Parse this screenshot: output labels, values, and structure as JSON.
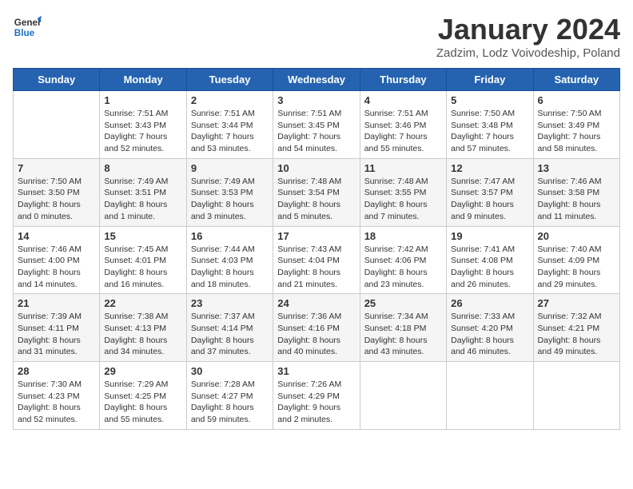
{
  "header": {
    "logo_general": "General",
    "logo_blue": "Blue",
    "title": "January 2024",
    "subtitle": "Zadzim, Lodz Voivodeship, Poland"
  },
  "days_of_week": [
    "Sunday",
    "Monday",
    "Tuesday",
    "Wednesday",
    "Thursday",
    "Friday",
    "Saturday"
  ],
  "weeks": [
    [
      {
        "day": "",
        "text": ""
      },
      {
        "day": "1",
        "text": "Sunrise: 7:51 AM\nSunset: 3:43 PM\nDaylight: 7 hours\nand 52 minutes."
      },
      {
        "day": "2",
        "text": "Sunrise: 7:51 AM\nSunset: 3:44 PM\nDaylight: 7 hours\nand 53 minutes."
      },
      {
        "day": "3",
        "text": "Sunrise: 7:51 AM\nSunset: 3:45 PM\nDaylight: 7 hours\nand 54 minutes."
      },
      {
        "day": "4",
        "text": "Sunrise: 7:51 AM\nSunset: 3:46 PM\nDaylight: 7 hours\nand 55 minutes."
      },
      {
        "day": "5",
        "text": "Sunrise: 7:50 AM\nSunset: 3:48 PM\nDaylight: 7 hours\nand 57 minutes."
      },
      {
        "day": "6",
        "text": "Sunrise: 7:50 AM\nSunset: 3:49 PM\nDaylight: 7 hours\nand 58 minutes."
      }
    ],
    [
      {
        "day": "7",
        "text": "Sunrise: 7:50 AM\nSunset: 3:50 PM\nDaylight: 8 hours\nand 0 minutes."
      },
      {
        "day": "8",
        "text": "Sunrise: 7:49 AM\nSunset: 3:51 PM\nDaylight: 8 hours\nand 1 minute."
      },
      {
        "day": "9",
        "text": "Sunrise: 7:49 AM\nSunset: 3:53 PM\nDaylight: 8 hours\nand 3 minutes."
      },
      {
        "day": "10",
        "text": "Sunrise: 7:48 AM\nSunset: 3:54 PM\nDaylight: 8 hours\nand 5 minutes."
      },
      {
        "day": "11",
        "text": "Sunrise: 7:48 AM\nSunset: 3:55 PM\nDaylight: 8 hours\nand 7 minutes."
      },
      {
        "day": "12",
        "text": "Sunrise: 7:47 AM\nSunset: 3:57 PM\nDaylight: 8 hours\nand 9 minutes."
      },
      {
        "day": "13",
        "text": "Sunrise: 7:46 AM\nSunset: 3:58 PM\nDaylight: 8 hours\nand 11 minutes."
      }
    ],
    [
      {
        "day": "14",
        "text": "Sunrise: 7:46 AM\nSunset: 4:00 PM\nDaylight: 8 hours\nand 14 minutes."
      },
      {
        "day": "15",
        "text": "Sunrise: 7:45 AM\nSunset: 4:01 PM\nDaylight: 8 hours\nand 16 minutes."
      },
      {
        "day": "16",
        "text": "Sunrise: 7:44 AM\nSunset: 4:03 PM\nDaylight: 8 hours\nand 18 minutes."
      },
      {
        "day": "17",
        "text": "Sunrise: 7:43 AM\nSunset: 4:04 PM\nDaylight: 8 hours\nand 21 minutes."
      },
      {
        "day": "18",
        "text": "Sunrise: 7:42 AM\nSunset: 4:06 PM\nDaylight: 8 hours\nand 23 minutes."
      },
      {
        "day": "19",
        "text": "Sunrise: 7:41 AM\nSunset: 4:08 PM\nDaylight: 8 hours\nand 26 minutes."
      },
      {
        "day": "20",
        "text": "Sunrise: 7:40 AM\nSunset: 4:09 PM\nDaylight: 8 hours\nand 29 minutes."
      }
    ],
    [
      {
        "day": "21",
        "text": "Sunrise: 7:39 AM\nSunset: 4:11 PM\nDaylight: 8 hours\nand 31 minutes."
      },
      {
        "day": "22",
        "text": "Sunrise: 7:38 AM\nSunset: 4:13 PM\nDaylight: 8 hours\nand 34 minutes."
      },
      {
        "day": "23",
        "text": "Sunrise: 7:37 AM\nSunset: 4:14 PM\nDaylight: 8 hours\nand 37 minutes."
      },
      {
        "day": "24",
        "text": "Sunrise: 7:36 AM\nSunset: 4:16 PM\nDaylight: 8 hours\nand 40 minutes."
      },
      {
        "day": "25",
        "text": "Sunrise: 7:34 AM\nSunset: 4:18 PM\nDaylight: 8 hours\nand 43 minutes."
      },
      {
        "day": "26",
        "text": "Sunrise: 7:33 AM\nSunset: 4:20 PM\nDaylight: 8 hours\nand 46 minutes."
      },
      {
        "day": "27",
        "text": "Sunrise: 7:32 AM\nSunset: 4:21 PM\nDaylight: 8 hours\nand 49 minutes."
      }
    ],
    [
      {
        "day": "28",
        "text": "Sunrise: 7:30 AM\nSunset: 4:23 PM\nDaylight: 8 hours\nand 52 minutes."
      },
      {
        "day": "29",
        "text": "Sunrise: 7:29 AM\nSunset: 4:25 PM\nDaylight: 8 hours\nand 55 minutes."
      },
      {
        "day": "30",
        "text": "Sunrise: 7:28 AM\nSunset: 4:27 PM\nDaylight: 8 hours\nand 59 minutes."
      },
      {
        "day": "31",
        "text": "Sunrise: 7:26 AM\nSunset: 4:29 PM\nDaylight: 9 hours\nand 2 minutes."
      },
      {
        "day": "",
        "text": ""
      },
      {
        "day": "",
        "text": ""
      },
      {
        "day": "",
        "text": ""
      }
    ]
  ]
}
